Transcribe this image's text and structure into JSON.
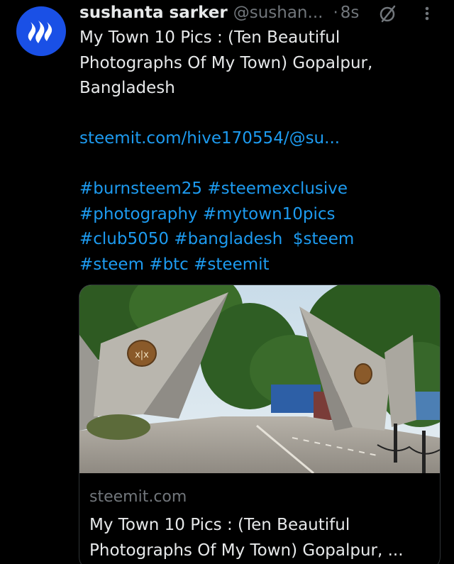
{
  "author": {
    "display_name": "sushanta sarker",
    "handle": "@sushan...",
    "separator": "·",
    "time": "8s",
    "avatar_icon": "steem-logo-icon",
    "avatar_color": "#1a50e6"
  },
  "tweet": {
    "lines": [
      "My Town 10 Pics : (Ten Beautiful",
      "Photographs Of My Town) Gopalpur,",
      "Bangladesh"
    ],
    "link": "steemit.com/hive170554/@su...",
    "tags": {
      "line1": [
        "#burnsteem25",
        "#steemexclusive"
      ],
      "line2": [
        "#photography",
        "#mytown10pics"
      ],
      "line3": [
        "#club5050",
        "#bangladesh",
        "$steem"
      ],
      "line4": [
        "#steem",
        "#btc",
        "#steemit"
      ]
    }
  },
  "card": {
    "domain": "steemit.com",
    "title_line1": "My Town 10 Pics : (Ten Beautiful",
    "title_line2": "Photographs Of My Town) Gopalpur, ..."
  },
  "colors": {
    "background": "#000000",
    "text": "#e7e9ea",
    "secondary": "#71767b",
    "link": "#1d9bf0"
  },
  "icons": {
    "edit": "edit-disabled-icon",
    "more": "more-options-icon"
  }
}
